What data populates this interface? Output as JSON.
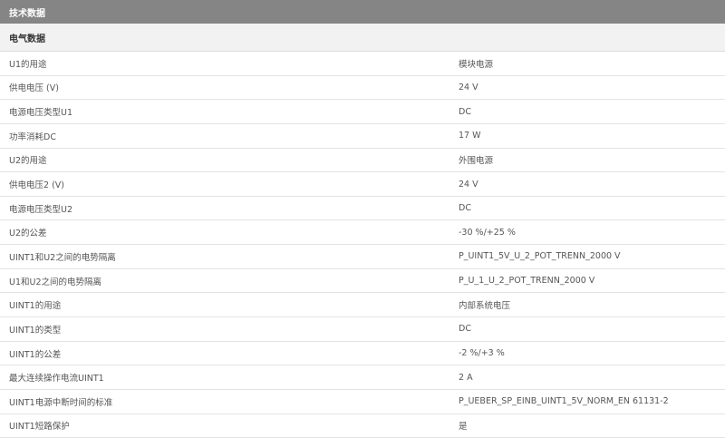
{
  "section_title": "技术数据",
  "subsection_title": "电气数据",
  "rows": [
    {
      "label": "U1的用途",
      "value": "模块电源"
    },
    {
      "label": "供电电压 (V)",
      "value": "24  V"
    },
    {
      "label": "电源电压类型U1",
      "value": "DC"
    },
    {
      "label": "功率消耗DC",
      "value": "17  W"
    },
    {
      "label": "U2的用途",
      "value": "外围电源"
    },
    {
      "label": "供电电压2 (V)",
      "value": "24  V"
    },
    {
      "label": "电源电压类型U2",
      "value": "DC"
    },
    {
      "label": "U2的公差",
      "value": "-30 %/+25 %"
    },
    {
      "label": "UINT1和U2之间的电势隔离",
      "value": "P_UINT1_5V_U_2_POT_TRENN_2000 V"
    },
    {
      "label": "U1和U2之间的电势隔离",
      "value": "P_U_1_U_2_POT_TRENN_2000 V"
    },
    {
      "label": "UINT1的用途",
      "value": "内部系统电压"
    },
    {
      "label": "UINT1的类型",
      "value": "DC"
    },
    {
      "label": "UINT1的公差",
      "value": "-2 %/+3 %"
    },
    {
      "label": "最大连续操作电流UINT1",
      "value": "2  A"
    },
    {
      "label": "UINT1电源中断时间的标准",
      "value": "P_UEBER_SP_EINB_UINT1_5V_NORM_EN 61131-2"
    },
    {
      "label": "UINT1短路保护",
      "value": "是"
    }
  ]
}
